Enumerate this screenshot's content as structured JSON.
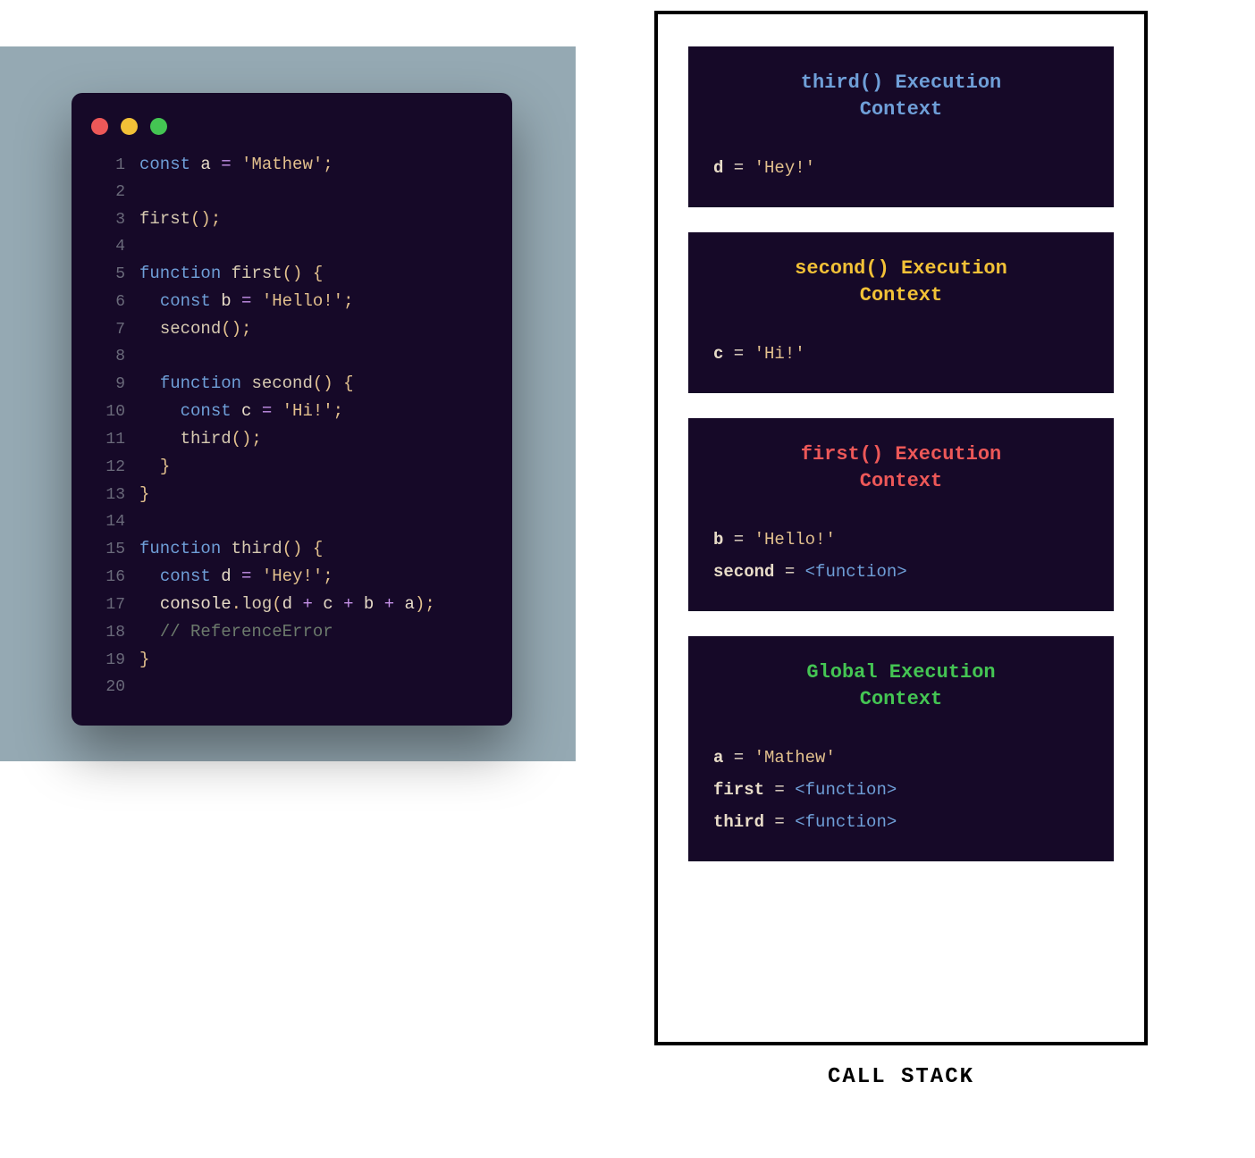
{
  "code": {
    "lines": [
      {
        "n": "1",
        "tokens": [
          {
            "cls": "tok-kw",
            "t": "const "
          },
          {
            "cls": "tok-var",
            "t": "a"
          },
          {
            "cls": "tok-op",
            "t": " = "
          },
          {
            "cls": "tok-str",
            "t": "'Mathew'"
          },
          {
            "cls": "tok-pun",
            "t": ";"
          }
        ]
      },
      {
        "n": "2",
        "tokens": []
      },
      {
        "n": "3",
        "tokens": [
          {
            "cls": "tok-fn",
            "t": "first"
          },
          {
            "cls": "tok-pun",
            "t": "();"
          }
        ]
      },
      {
        "n": "4",
        "tokens": []
      },
      {
        "n": "5",
        "tokens": [
          {
            "cls": "tok-kw",
            "t": "function "
          },
          {
            "cls": "tok-fn",
            "t": "first"
          },
          {
            "cls": "tok-pun",
            "t": "() {"
          }
        ]
      },
      {
        "n": "6",
        "tokens": [
          {
            "cls": "tok-plain",
            "t": "  "
          },
          {
            "cls": "tok-kw",
            "t": "const "
          },
          {
            "cls": "tok-var",
            "t": "b"
          },
          {
            "cls": "tok-op",
            "t": " = "
          },
          {
            "cls": "tok-str",
            "t": "'Hello!'"
          },
          {
            "cls": "tok-pun",
            "t": ";"
          }
        ]
      },
      {
        "n": "7",
        "tokens": [
          {
            "cls": "tok-plain",
            "t": "  "
          },
          {
            "cls": "tok-fn",
            "t": "second"
          },
          {
            "cls": "tok-pun",
            "t": "();"
          }
        ]
      },
      {
        "n": "8",
        "tokens": []
      },
      {
        "n": "9",
        "tokens": [
          {
            "cls": "tok-plain",
            "t": "  "
          },
          {
            "cls": "tok-kw",
            "t": "function "
          },
          {
            "cls": "tok-fn",
            "t": "second"
          },
          {
            "cls": "tok-pun",
            "t": "() {"
          }
        ]
      },
      {
        "n": "10",
        "tokens": [
          {
            "cls": "tok-plain",
            "t": "    "
          },
          {
            "cls": "tok-kw",
            "t": "const "
          },
          {
            "cls": "tok-var",
            "t": "c"
          },
          {
            "cls": "tok-op",
            "t": " = "
          },
          {
            "cls": "tok-str",
            "t": "'Hi!'"
          },
          {
            "cls": "tok-pun",
            "t": ";"
          }
        ]
      },
      {
        "n": "11",
        "tokens": [
          {
            "cls": "tok-plain",
            "t": "    "
          },
          {
            "cls": "tok-fn",
            "t": "third"
          },
          {
            "cls": "tok-pun",
            "t": "();"
          }
        ]
      },
      {
        "n": "12",
        "tokens": [
          {
            "cls": "tok-plain",
            "t": "  "
          },
          {
            "cls": "tok-pun",
            "t": "}"
          }
        ]
      },
      {
        "n": "13",
        "tokens": [
          {
            "cls": "tok-pun",
            "t": "}"
          }
        ]
      },
      {
        "n": "14",
        "tokens": []
      },
      {
        "n": "15",
        "tokens": [
          {
            "cls": "tok-kw",
            "t": "function "
          },
          {
            "cls": "tok-fn",
            "t": "third"
          },
          {
            "cls": "tok-pun",
            "t": "() {"
          }
        ]
      },
      {
        "n": "16",
        "tokens": [
          {
            "cls": "tok-plain",
            "t": "  "
          },
          {
            "cls": "tok-kw",
            "t": "const "
          },
          {
            "cls": "tok-var",
            "t": "d"
          },
          {
            "cls": "tok-op",
            "t": " = "
          },
          {
            "cls": "tok-str",
            "t": "'Hey!'"
          },
          {
            "cls": "tok-pun",
            "t": ";"
          }
        ]
      },
      {
        "n": "17",
        "tokens": [
          {
            "cls": "tok-plain",
            "t": "  "
          },
          {
            "cls": "tok-console",
            "t": "console"
          },
          {
            "cls": "tok-pun",
            "t": "."
          },
          {
            "cls": "tok-fn",
            "t": "log"
          },
          {
            "cls": "tok-pun",
            "t": "("
          },
          {
            "cls": "tok-var",
            "t": "d"
          },
          {
            "cls": "tok-op",
            "t": " + "
          },
          {
            "cls": "tok-var",
            "t": "c"
          },
          {
            "cls": "tok-op",
            "t": " + "
          },
          {
            "cls": "tok-var",
            "t": "b"
          },
          {
            "cls": "tok-op",
            "t": " + "
          },
          {
            "cls": "tok-var",
            "t": "a"
          },
          {
            "cls": "tok-pun",
            "t": ");"
          }
        ]
      },
      {
        "n": "18",
        "tokens": [
          {
            "cls": "tok-plain",
            "t": "  "
          },
          {
            "cls": "tok-comment",
            "t": "// ReferenceError"
          }
        ]
      },
      {
        "n": "19",
        "tokens": [
          {
            "cls": "tok-pun",
            "t": "}"
          }
        ]
      },
      {
        "n": "20",
        "tokens": []
      }
    ]
  },
  "callstack": {
    "label": "CALL STACK",
    "frames": [
      {
        "title_line1": "third() Execution",
        "title_line2": "Context",
        "title_class": "title-third",
        "vars": [
          {
            "name": "d",
            "eq": " = ",
            "value": "'Hey!'",
            "vtype": "str"
          }
        ]
      },
      {
        "title_line1": "second() Execution",
        "title_line2": "Context",
        "title_class": "title-second",
        "vars": [
          {
            "name": "c",
            "eq": " = ",
            "value": "'Hi!'",
            "vtype": "str"
          }
        ]
      },
      {
        "title_line1": "first() Execution",
        "title_line2": "Context",
        "title_class": "title-first",
        "vars": [
          {
            "name": "b",
            "eq": " = ",
            "value": "'Hello!'",
            "vtype": "str"
          },
          {
            "name": "second",
            "eq": " = ",
            "value": "<function>",
            "vtype": "fn"
          }
        ]
      },
      {
        "title_line1": "Global Execution",
        "title_line2": "Context",
        "title_class": "title-global",
        "vars": [
          {
            "name": "a",
            "eq": " = ",
            "value": "'Mathew'",
            "vtype": "str"
          },
          {
            "name": "first",
            "eq": " = ",
            "value": "<function>",
            "vtype": "fn"
          },
          {
            "name": "third",
            "eq": " = ",
            "value": "<function>",
            "vtype": "fn"
          }
        ]
      }
    ]
  }
}
